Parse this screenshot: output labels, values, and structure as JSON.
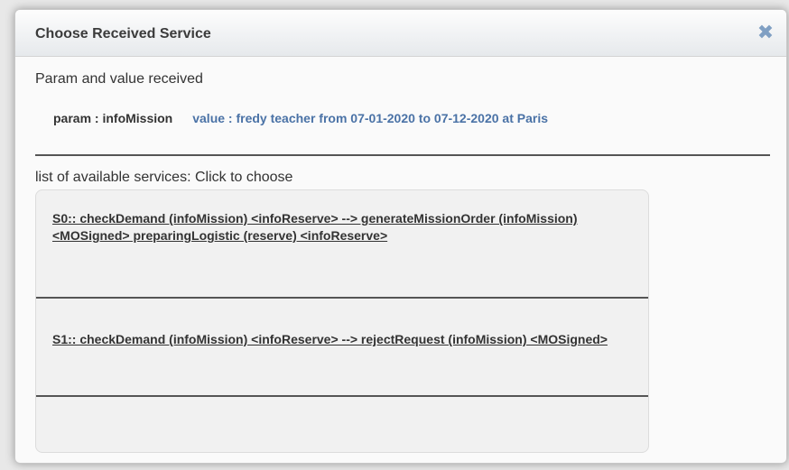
{
  "dialog": {
    "title": "Choose Received Service",
    "close_icon": "close-x-icon"
  },
  "received": {
    "heading": "Param and value received",
    "param_label": "param : infoMission",
    "value_label": "value : fredy teacher from 07-01-2020 to 07-12-2020 at Paris"
  },
  "services": {
    "heading": "list of available services: Click to choose",
    "items": [
      {
        "label": "S0:: checkDemand (infoMission) <infoReserve> --> generateMissionOrder (infoMission) <MOSigned> preparingLogistic (reserve) <infoReserve>"
      },
      {
        "label": "S1:: checkDemand (infoMission) <infoReserve> --> rejectRequest (infoMission) <MOSigned>"
      }
    ]
  },
  "colors": {
    "accent": "#4a72a6",
    "close_icon": "#7f9fc3"
  }
}
